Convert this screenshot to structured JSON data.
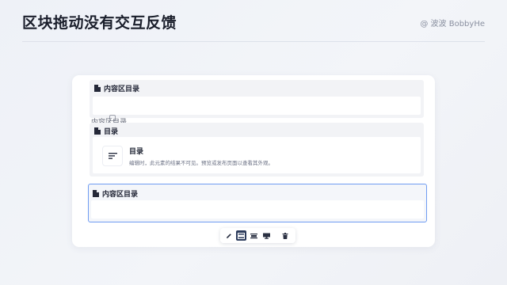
{
  "header": {
    "title": "区块拖动没有交互反馈",
    "author": "@ 波波 BobbyHe"
  },
  "blocks": [
    {
      "label": "内容区目录"
    },
    {
      "label": "目录",
      "card": {
        "title": "目录",
        "description": "编辑时，此元素的结果不可见。预览或发布页面以查看其外观。"
      }
    },
    {
      "label": "内容区目录"
    }
  ],
  "drag_ghost": {
    "label": "内容区目录"
  },
  "toolbar": {
    "buttons": [
      {
        "icon": "pencil-icon",
        "active": false
      },
      {
        "icon": "layout-full-icon",
        "active": true
      },
      {
        "icon": "layout-center-icon",
        "active": false
      },
      {
        "icon": "monitor-icon",
        "active": false
      },
      {
        "icon": "trash-icon",
        "active": false
      }
    ]
  },
  "colors": {
    "accent": "#6f9cf2",
    "active_button": "#2c3b5c"
  }
}
